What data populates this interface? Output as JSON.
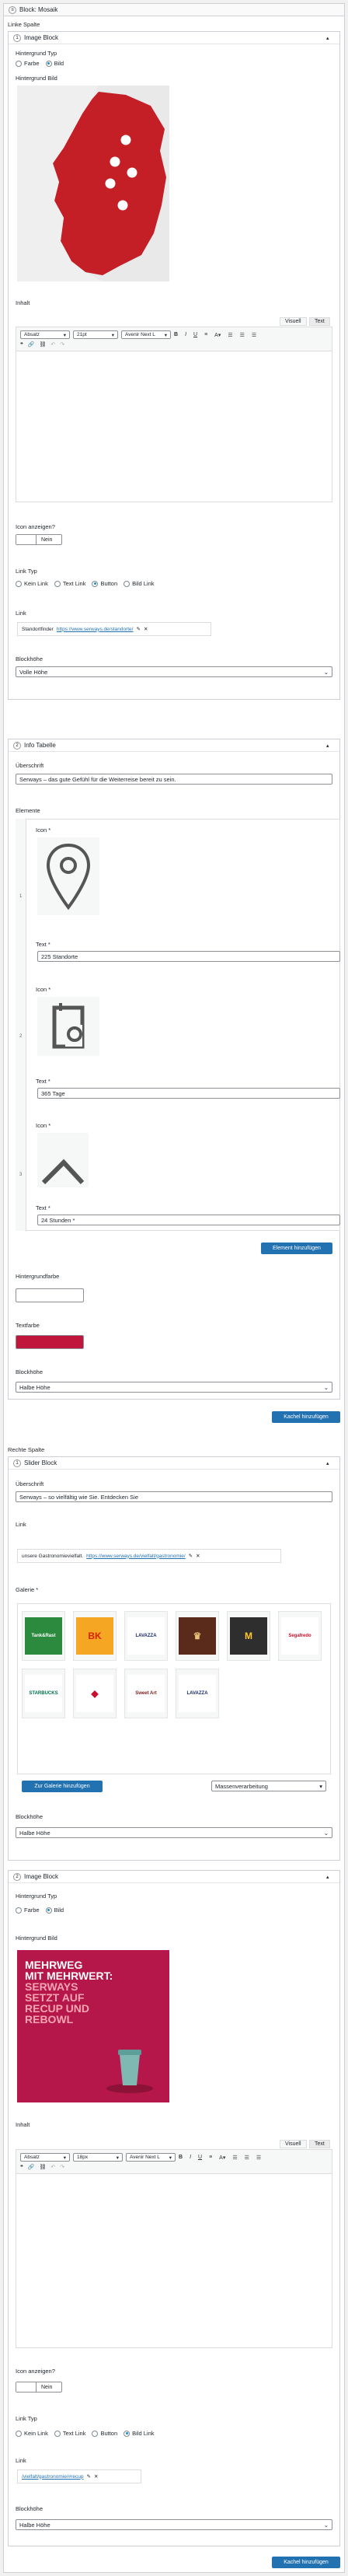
{
  "block_title": "Block: Mosaik",
  "left_column_label": "Linke Spalte",
  "right_column_label": "Rechte Spalte",
  "image_block_1": {
    "number": "1",
    "title": "Image Block",
    "bg_type_label": "Hintergrund Typ",
    "bg_type_options": [
      "Farbe",
      "Bild"
    ],
    "bg_type_selected": "Bild",
    "bg_image_label": "Hintergrund Bild",
    "content_label": "Inhalt",
    "tab_visual": "Visuell",
    "tab_text": "Text",
    "format": "Absatz",
    "font_size": "21pt",
    "font_family": "Avenir Next L",
    "show_icon_label": "Icon anzeigen?",
    "show_icon_value": "Nein",
    "link_type_label": "Link Typ",
    "link_type_options": [
      "Kein Link",
      "Text Link",
      "Button",
      "Bild Link"
    ],
    "link_type_selected": "Button",
    "link_label": "Link",
    "link_text": "Standortfinder",
    "link_url": "https://www.serways.de/standorte/",
    "block_height_label": "Blockhöhe",
    "block_height_value": "Volle Höhe"
  },
  "info_table": {
    "number": "2",
    "title": "Info Tabelle",
    "heading_label": "Überschrift",
    "heading_value": "Serways – das gute Gefühl für die Weiterreise bereit zu sein.",
    "elements_label": "Elemente",
    "items": [
      {
        "index": "1",
        "icon_label": "Icon *",
        "text_label": "Text *",
        "text": "225 Standorte",
        "icon": "location-pin-icon"
      },
      {
        "index": "2",
        "icon_label": "Icon *",
        "text_label": "Text *",
        "text": "365 Tage",
        "icon": "calendar-icon"
      },
      {
        "index": "3",
        "icon_label": "Icon *",
        "text_label": "Text *",
        "text": "24 Stunden *",
        "icon": "clock-icon"
      }
    ],
    "add_element": "Element hinzufügen",
    "bg_color_label": "Hintergrundfarbe",
    "text_color_label": "Textfarbe",
    "text_color": "#c0163c",
    "block_height_label": "Blockhöhe",
    "block_height_value": "Halbe Höhe"
  },
  "add_tile_left": "Kachel hinzufügen",
  "slider_block": {
    "number": "1",
    "title": "Slider Block",
    "heading_label": "Überschrift",
    "heading_value": "Serways – so vielfältig wie Sie. Entdecken Sie",
    "link_label": "Link",
    "link_text": "unsere Gastronomievielfalt.",
    "link_url": "https://www.serways.de/vielfalt/gastronomie/",
    "gallery_label": "Galerie *",
    "logos": [
      {
        "name": "Tank & Rast green",
        "text": "Tank&Rast",
        "bg": "#2b8a3e",
        "color": "#ffffff"
      },
      {
        "name": "Burger King",
        "text": "BK",
        "bg": "#f5a623",
        "color": "#d62300"
      },
      {
        "name": "Lavazza",
        "text": "LAVAZZA",
        "bg": "#ffffff",
        "color": "#1a2a6c"
      },
      {
        "name": "Nordsee",
        "text": "♛",
        "bg": "#5a2a1a",
        "color": "#e8c07a"
      },
      {
        "name": "McDonald's",
        "text": "M",
        "bg": "#2e2e2e",
        "color": "#ffc72c"
      },
      {
        "name": "Segafredo",
        "text": "Segafredo",
        "bg": "#ffffff",
        "color": "#c8102e"
      },
      {
        "name": "Starbucks",
        "text": "STARBUCKS",
        "bg": "#ffffff",
        "color": "#00704a"
      },
      {
        "name": "Nordsee fish",
        "text": "◆",
        "bg": "#ffffff",
        "color": "#c8102e"
      },
      {
        "name": "Sweet Art",
        "text": "Sweet Art",
        "bg": "#ffffff",
        "color": "#7a1c1c"
      },
      {
        "name": "Lavazza 2",
        "text": "LAVAZZA",
        "bg": "#ffffff",
        "color": "#1a2a6c"
      }
    ],
    "add_gallery": "Zur Galerie hinzufügen",
    "bulk_edit": "Massenverarbeitung",
    "block_height_label": "Blockhöhe",
    "block_height_value": "Halbe Höhe"
  },
  "image_block_2": {
    "number": "2",
    "title": "Image Block",
    "bg_type_label": "Hintergrund Typ",
    "bg_type_options": [
      "Farbe",
      "Bild"
    ],
    "bg_type_selected": "Bild",
    "bg_image_label": "Hintergrund Bild",
    "poster_line1": "MEHRWEG",
    "poster_line2": "MIT MEHRWERT:",
    "poster_line3": "SERWAYS",
    "poster_line4": "SETZT AUF",
    "poster_line5": "RECUP UND",
    "poster_line6": "REBOWL",
    "content_label": "Inhalt",
    "tab_visual": "Visuell",
    "tab_text": "Text",
    "format": "Absatz",
    "font_size": "18px",
    "font_family": "Avenir Next L",
    "show_icon_label": "Icon anzeigen?",
    "show_icon_value": "Nein",
    "link_type_label": "Link Typ",
    "link_type_options": [
      "Kein Link",
      "Text Link",
      "Button",
      "Bild Link"
    ],
    "link_type_selected": "Bild Link",
    "link_label": "Link",
    "link_url": "/vielfalt/gastronomie/#recup",
    "block_height_label": "Blockhöhe",
    "block_height_value": "Halbe Höhe"
  },
  "add_tile_right": "Kachel hinzufügen",
  "colors": {
    "accent": "#2271b1",
    "brand_red": "#c0163c"
  }
}
